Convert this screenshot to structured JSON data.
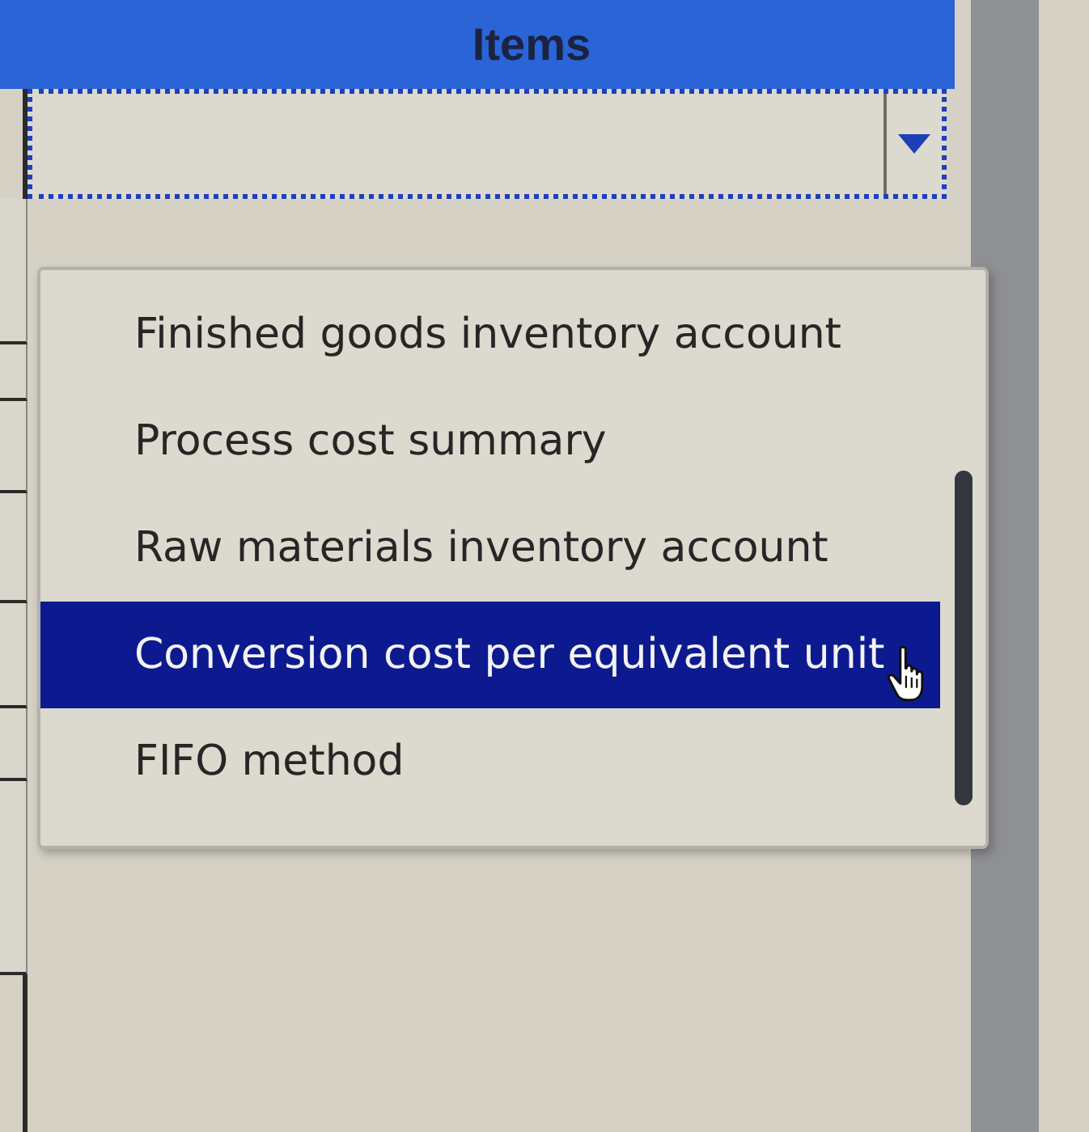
{
  "header": {
    "title": "Items"
  },
  "select": {
    "expanded": true
  },
  "options": [
    {
      "label": "Finished goods inventory account",
      "selected": false
    },
    {
      "label": "Process cost summary",
      "selected": false
    },
    {
      "label": "Raw materials inventory account",
      "selected": false
    },
    {
      "label": "Conversion cost per equivalent unit",
      "selected": true
    },
    {
      "label": "FIFO method",
      "selected": false
    }
  ]
}
